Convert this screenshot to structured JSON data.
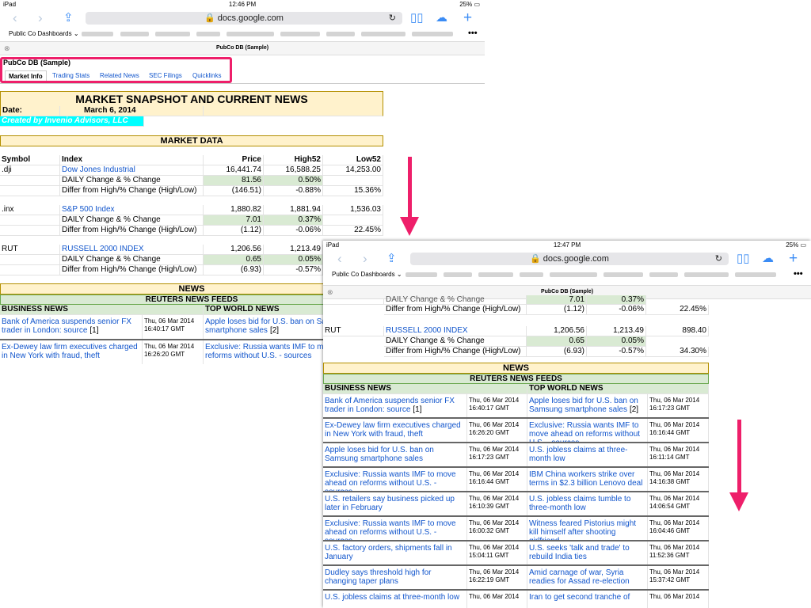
{
  "status": {
    "device": "iPad",
    "time_top": "12:46 PM",
    "time_bottom": "12:47 PM",
    "battery": "25%"
  },
  "browser": {
    "url": "docs.google.com",
    "bookmark_folder": "Public Co Dashboards ⌄",
    "tab_title": "PubCo DB (Sample)"
  },
  "doc": {
    "title": "PubCo DB (Sample)",
    "tabs": [
      "Market Info",
      "Trading Stats",
      "Related News",
      "SEC Filings",
      "Quicklinks"
    ]
  },
  "sheet": {
    "header": "MARKET SNAPSHOT AND CURRENT NEWS",
    "date_label": "Date:",
    "date_value": "March 6, 2014",
    "credit": "Created by Invenio Advisors, LLC",
    "market_header": "MARKET DATA",
    "columns": [
      "Symbol",
      "Index",
      "Price",
      "High52",
      "Low52"
    ],
    "daily_label": "DAILY Change & % Change",
    "differ_label": "Differ from High/% Change (High/Low)",
    "indices": [
      {
        "symbol": ".dji",
        "name": "Dow Jones Industrial",
        "price": "16,441.74",
        "high": "16,588.25",
        "low": "14,253.00",
        "chg": "81.56",
        "pct": "0.50%",
        "dif": "(146.51)",
        "difpct": "-0.88%",
        "lowpct": "15.36%"
      },
      {
        "symbol": ".inx",
        "name": "S&P 500 Index",
        "price": "1,880.82",
        "high": "1,881.94",
        "low": "1,536.03",
        "chg": "7.01",
        "pct": "0.37%",
        "dif": "(1.12)",
        "difpct": "-0.06%",
        "lowpct": "22.45%"
      },
      {
        "symbol": "RUT",
        "name": "RUSSELL 2000 INDEX",
        "price": "1,206.56",
        "high": "1,213.49",
        "low": "898.40",
        "chg": "0.65",
        "pct": "0.05%",
        "dif": "(6.93)",
        "difpct": "-0.57%",
        "lowpct": "34.30%"
      }
    ],
    "partial_row": {
      "a": "DAILY Change & % Change",
      "b": "7.01",
      "c": "0.37%"
    },
    "news_header": "NEWS",
    "feeds_header": "REUTERS NEWS FEEDS",
    "business_header": "BUSINESS NEWS",
    "world_header": "TOP WORLD NEWS",
    "news": [
      {
        "b": "Bank of America suspends senior FX trader in London: source",
        "bs": "[1]",
        "bd": "Thu, 06 Mar 2014",
        "bt": "16:40:17 GMT",
        "w": "Apple loses bid for U.S. ban on Samsung smartphone sales",
        "ws": "[2]",
        "wd": "Thu, 06 Mar 2014",
        "wt": "16:17:23 GMT"
      },
      {
        "b": "Ex-Dewey law firm executives charged in New York with fraud, theft",
        "bs": "",
        "bd": "Thu, 06 Mar 2014",
        "bt": "16:26:20 GMT",
        "w": "Exclusive: Russia wants IMF to move ahead on reforms without U.S. - sources",
        "ws": "",
        "wd": "Thu, 06 Mar 2014",
        "wt": "16:16:44 GMT"
      },
      {
        "b": "Apple loses bid for U.S. ban on Samsung smartphone sales",
        "bs": "",
        "bd": "Thu, 06 Mar 2014",
        "bt": "16:17:23 GMT",
        "w": "U.S. jobless claims at three-month low",
        "ws": "",
        "wd": "Thu, 06 Mar 2014",
        "wt": "16:11:14 GMT"
      },
      {
        "b": "Exclusive: Russia wants IMF to move ahead on reforms without U.S. - sources",
        "bs": "",
        "bd": "Thu, 06 Mar 2014",
        "bt": "16:16:44 GMT",
        "w": "IBM China workers strike over terms in $2.3 billion Lenovo deal",
        "ws": "",
        "wd": "Thu, 06 Mar 2014",
        "wt": "14:16:38 GMT"
      },
      {
        "b": "U.S. retailers say business picked up later in February",
        "bs": "",
        "bd": "Thu, 06 Mar 2014",
        "bt": "16:10:39 GMT",
        "w": "U.S. jobless claims tumble to three-month low",
        "ws": "",
        "wd": "Thu, 06 Mar 2014",
        "wt": "14:06:54 GMT"
      },
      {
        "b": "Exclusive: Russia wants IMF to move ahead on reforms without U.S. - sources",
        "bs": "",
        "bd": "Thu, 06 Mar 2014",
        "bt": "16:00:32 GMT",
        "w": "Witness feared Pistorius might kill himself after shooting girlfriend",
        "ws": "",
        "wd": "Thu, 06 Mar 2014",
        "wt": "16:04:46 GMT"
      },
      {
        "b": "U.S. factory orders, shipments fall in January",
        "bs": "",
        "bd": "Thu, 06 Mar 2014",
        "bt": "15:04:11 GMT",
        "w": "U.S. seeks 'talk and trade' to rebuild India ties",
        "ws": "",
        "wd": "Thu, 06 Mar 2014",
        "wt": "11:52:36 GMT"
      },
      {
        "b": "Dudley says threshold high for changing taper plans",
        "bs": "",
        "bd": "Thu, 06 Mar 2014",
        "bt": "16:22:19 GMT",
        "w": "Amid carnage of war, Syria readies for Assad re-election",
        "ws": "",
        "wd": "Thu, 06 Mar 2014",
        "wt": "15:37:42 GMT"
      },
      {
        "b": "U.S. jobless claims at three-month low",
        "bs": "",
        "bd": "Thu, 06 Mar 2014",
        "bt": "",
        "w": "Iran to get second tranche of",
        "ws": "",
        "wd": "Thu, 06 Mar 2014",
        "wt": ""
      }
    ]
  },
  "colors": {
    "highlight": "#ee1f6a",
    "link": "#1155cc",
    "header_fill": "#fff2cc",
    "change_fill": "#d9ead3",
    "credit_fill": "#00ffff"
  }
}
